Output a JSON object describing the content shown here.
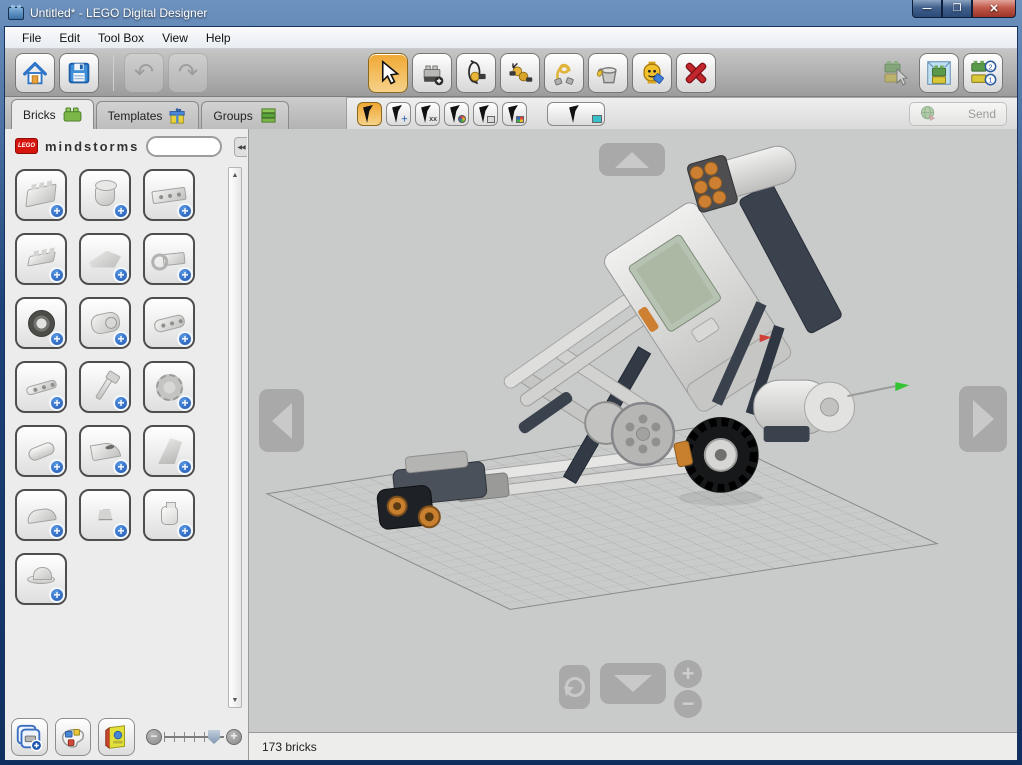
{
  "window": {
    "title": "Untitled* - LEGO Digital Designer"
  },
  "menu": {
    "items": [
      {
        "label": "File"
      },
      {
        "label": "Edit"
      },
      {
        "label": "Tool Box"
      },
      {
        "label": "View"
      },
      {
        "label": "Help"
      }
    ]
  },
  "toolbar": {
    "left_icons": [
      "home-icon",
      "save-icon",
      "undo-icon",
      "redo-icon"
    ],
    "tools": [
      "select-tool",
      "clone-tool",
      "hinge-tool",
      "hinge-align-tool",
      "flex-tool",
      "paint-tool",
      "hide-tool",
      "delete-tool"
    ],
    "modes": [
      "build-mode",
      "view-mode",
      "building-guide-mode"
    ],
    "active_tool": "select-tool"
  },
  "tabs": {
    "bricks": "Bricks",
    "templates": "Templates",
    "groups": "Groups",
    "active": "Bricks"
  },
  "selection_modes": [
    "single-select",
    "add-select",
    "connected-select",
    "color-select",
    "shape-select",
    "color-shape-select",
    "invert-select"
  ],
  "topbar": {
    "send_label": "Send",
    "send_enabled": false
  },
  "sidebar": {
    "brand": "mindstorms",
    "search": {
      "value": "",
      "placeholder": ""
    },
    "palette_items": [
      {
        "name": "brick-2x3"
      },
      {
        "name": "brick-round"
      },
      {
        "name": "technic-brick-1x4"
      },
      {
        "name": "plate-2x2"
      },
      {
        "name": "wedge-plate"
      },
      {
        "name": "plate-with-clip"
      },
      {
        "name": "wheel-tire"
      },
      {
        "name": "technic-motor"
      },
      {
        "name": "beam-3"
      },
      {
        "name": "thin-liftarm"
      },
      {
        "name": "axle-pin"
      },
      {
        "name": "gear-wheel"
      },
      {
        "name": "tube"
      },
      {
        "name": "curved-panel"
      },
      {
        "name": "tail-fin"
      },
      {
        "name": "mudguard"
      },
      {
        "name": "minifigure"
      },
      {
        "name": "minifig-head"
      },
      {
        "name": "hat"
      }
    ]
  },
  "statusbar": {
    "brick_count": "173 bricks"
  },
  "colors": {
    "accent_orange": "#F0A832",
    "badge_blue": "#1C55B0",
    "delete_red": "#C1272D",
    "canvas_gray": "#C9CACA",
    "titlebar_blue": "#1D4279",
    "lego_red": "#D6150F"
  }
}
